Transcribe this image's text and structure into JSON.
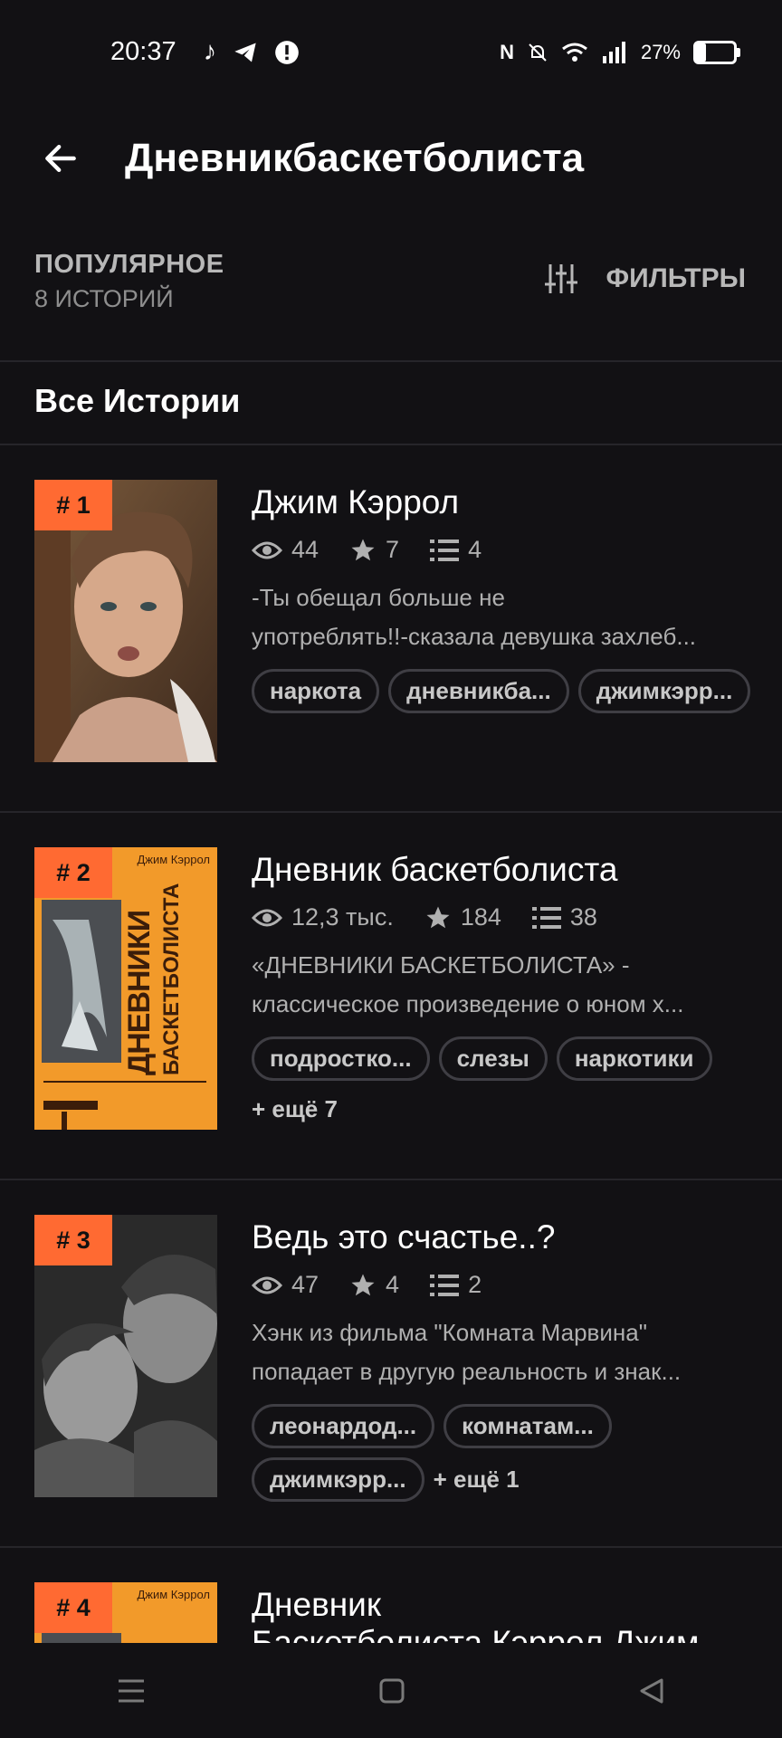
{
  "status": {
    "time": "20:37",
    "battery": "27%",
    "battery_level": 0.27
  },
  "header": {
    "title": "Дневникбаскетболиста"
  },
  "filter": {
    "sort_label": "ПОПУЛЯРНОЕ",
    "count": "8 ИСТОРИЙ",
    "filters_label": "ФИЛЬТРЫ"
  },
  "section_title": "Все Истории",
  "stories": [
    {
      "rank": "# 1",
      "title": "Джим Кэррол",
      "views": "44",
      "votes": "7",
      "parts": "4",
      "desc": [
        "-Ты обещал больше не",
        "употреблять!!-сказала девушка захлеб..."
      ],
      "tags": [
        "наркота",
        "дневникба...",
        "джимкэрр..."
      ],
      "more": ""
    },
    {
      "rank": "# 2",
      "title": "Дневник баскетболиста",
      "views": "12,3 тыс.",
      "votes": "184",
      "parts": "38",
      "desc": [
        "«ДНЕВНИКИ БАСКЕТБОЛИСТА» -",
        "классическое произведение о юном х..."
      ],
      "tags": [
        "подростко...",
        "слезы",
        "наркотики"
      ],
      "more": "+ ещё 7",
      "cover_text": {
        "author": "Джим Кэррол",
        "title1": "ДНЕВНИКИ",
        "title2": "БАСКЕТБОЛИСТА"
      }
    },
    {
      "rank": "# 3",
      "title": "Ведь это счастье..?",
      "views": "47",
      "votes": "4",
      "parts": "2",
      "desc": [
        "Хэнк из фильма \"Комната Марвина\"",
        "попадает в другую реальность и знак..."
      ],
      "tags": [
        "леонардод...",
        "комнатам...",
        "джимкэрр..."
      ],
      "more": "+ ещё 1"
    },
    {
      "rank": "# 4",
      "title": "Дневник",
      "title2": "Баскетболиста Кэррол Джим",
      "cover_text": {
        "author": "Джим Кэррол"
      }
    }
  ],
  "colors": {
    "background": "#121114",
    "accent": "#ff6a32",
    "muted": "#b0b0b0"
  }
}
